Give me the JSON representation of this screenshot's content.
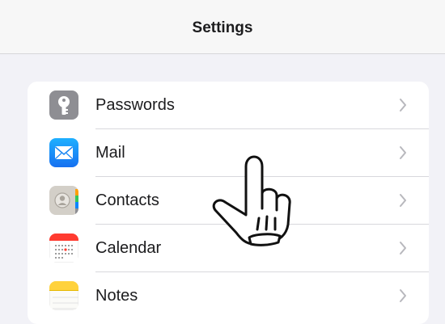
{
  "nav": {
    "title": "Settings"
  },
  "settings_list": {
    "items": [
      {
        "label": "Passwords",
        "icon": "key-icon",
        "color": "#8e8e93"
      },
      {
        "label": "Mail",
        "icon": "mail-icon",
        "color": "#1e88f5"
      },
      {
        "label": "Contacts",
        "icon": "contacts-icon",
        "color": "#cfcbc4"
      },
      {
        "label": "Calendar",
        "icon": "calendar-icon",
        "color": "#ffffff"
      },
      {
        "label": "Notes",
        "icon": "notes-icon",
        "color": "#ffd23c"
      }
    ]
  },
  "overlay": {
    "icon": "tap-hand-icon"
  }
}
